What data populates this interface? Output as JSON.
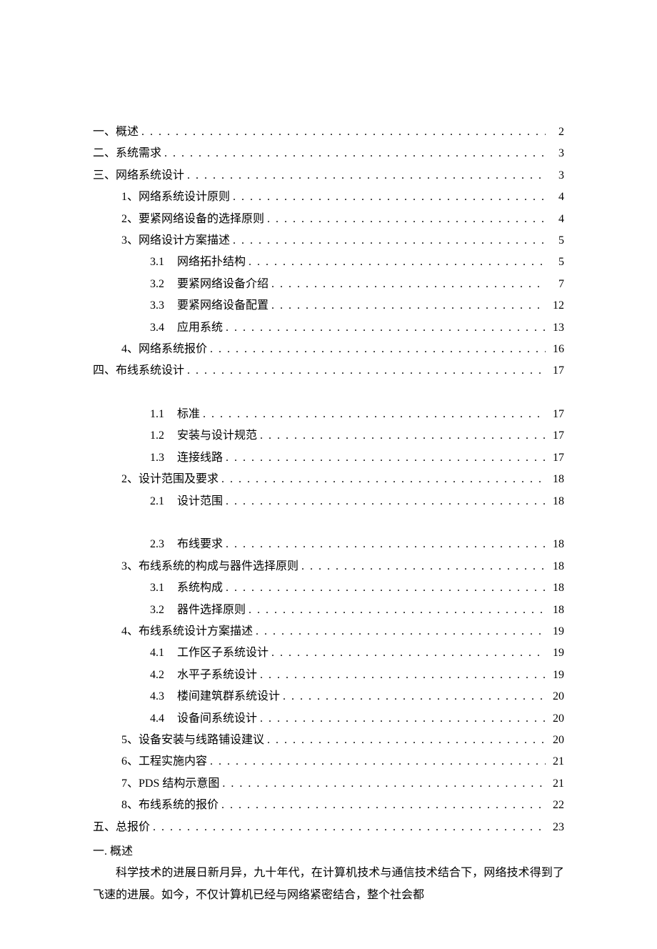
{
  "toc": {
    "entries": [
      {
        "indent": 0,
        "label": "一、概述",
        "page": "2"
      },
      {
        "indent": 0,
        "label": "二、系统需求",
        "page": "3"
      },
      {
        "indent": 0,
        "label": "三、网络系统设计",
        "page": "3"
      },
      {
        "indent": 1,
        "label": "1、网络系统设计原则",
        "page": "4"
      },
      {
        "indent": 1,
        "label": "2、要紧网络设备的选择原则",
        "page": "4"
      },
      {
        "indent": 1,
        "label": "3、网络设计方案描述",
        "page": "5"
      },
      {
        "indent": 2,
        "num": "3.1",
        "title": "网络拓扑结构",
        "page": "5"
      },
      {
        "indent": 2,
        "num": "3.2",
        "title": "要紧网络设备介绍",
        "page": "7"
      },
      {
        "indent": 2,
        "num": "3.3",
        "title": "要紧网络设备配置",
        "page": "12"
      },
      {
        "indent": 2,
        "num": "3.4",
        "title": "应用系统",
        "page": "13"
      },
      {
        "indent": 1,
        "label": "4、网络系统报价",
        "page": "16"
      },
      {
        "indent": 0,
        "label": "四、布线系统设计",
        "page": "17"
      },
      {
        "indent": -1
      },
      {
        "indent": 2,
        "num": "1.1",
        "title": "标准",
        "page": "17"
      },
      {
        "indent": 2,
        "num": "1.2",
        "title": "安装与设计规范",
        "page": "17"
      },
      {
        "indent": 2,
        "num": "1.3",
        "title": "连接线路",
        "page": "17"
      },
      {
        "indent": 1,
        "label": "2、设计范围及要求",
        "page": "18"
      },
      {
        "indent": 2,
        "num": "2.1",
        "title": "设计范围",
        "page": "18"
      },
      {
        "indent": -1
      },
      {
        "indent": 2,
        "num": "2.3",
        "title": "布线要求",
        "page": "18"
      },
      {
        "indent": 1,
        "label": "3、布线系统的构成与器件选择原则",
        "page": "18"
      },
      {
        "indent": 2,
        "num": "3.1",
        "title": "系统构成",
        "page": "18"
      },
      {
        "indent": 2,
        "num": "3.2",
        "title": "器件选择原则",
        "page": "18"
      },
      {
        "indent": 1,
        "label": "4、布线系统设计方案描述",
        "page": "19"
      },
      {
        "indent": 2,
        "num": "4.1",
        "title": "工作区子系统设计",
        "page": "19"
      },
      {
        "indent": 2,
        "num": "4.2",
        "title": "水平子系统设计",
        "page": "19"
      },
      {
        "indent": 2,
        "num": "4.3",
        "title": "楼间建筑群系统设计",
        "page": "20"
      },
      {
        "indent": 2,
        "num": "4.4",
        "title": "设备间系统设计",
        "page": "20"
      },
      {
        "indent": 1,
        "label": "5、设备安装与线路铺设建议",
        "page": "20"
      },
      {
        "indent": 1,
        "label": "6、工程实施内容",
        "page": "21"
      },
      {
        "indent": 1,
        "label": "7、PDS 结构示意图",
        "page": "21"
      },
      {
        "indent": 1,
        "label": "8、布线系统的报价",
        "page": "22"
      },
      {
        "indent": 0,
        "label": "五、总报价",
        "page": "23"
      }
    ]
  },
  "body": {
    "heading": "一. 概述",
    "para1": "科学技术的进展日新月异，九十年代，在计算机技术与通信技术结合下，网络技术得到了飞速的进展。如今，不仅计算机已经与网络紧密结合，整个社会都"
  }
}
